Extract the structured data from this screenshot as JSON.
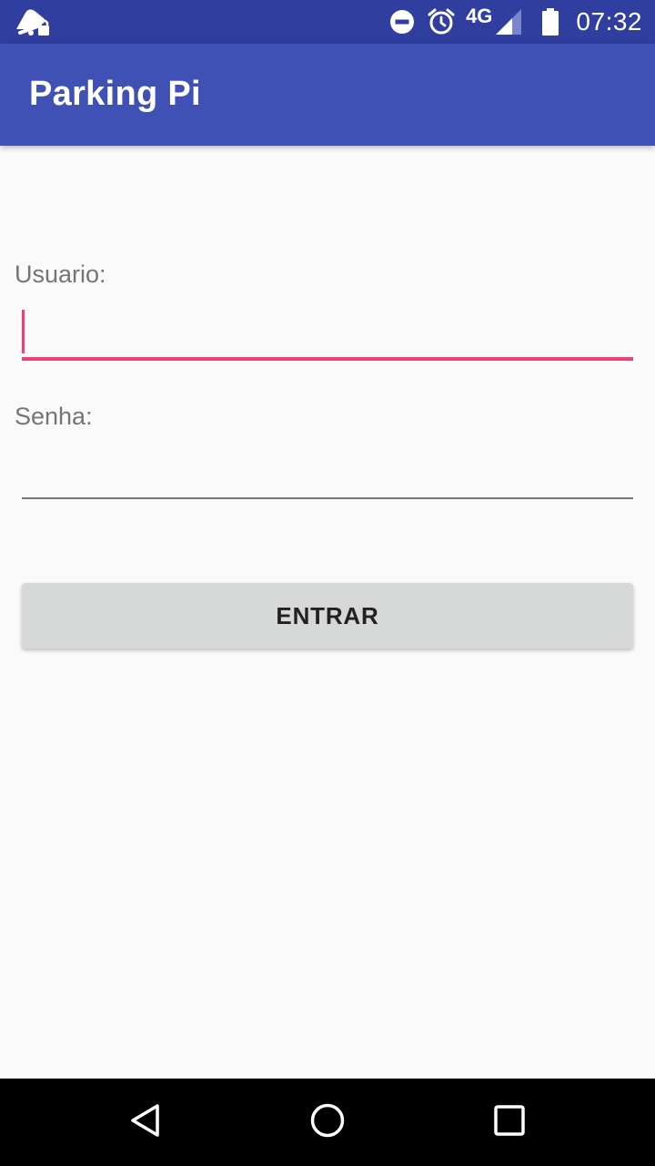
{
  "status_bar": {
    "left_icon": "notification-sleep-lock-icon",
    "icons": [
      "do-not-disturb-icon",
      "alarm-icon",
      "signal-icon",
      "battery-icon"
    ],
    "network": "4G",
    "time": "07:32",
    "color": "#303f9f"
  },
  "app_bar": {
    "title": "Parking Pi",
    "color": "#3f51b5"
  },
  "form": {
    "usuario_label": "Usuario:",
    "usuario_value": "",
    "senha_label": "Senha:",
    "senha_value": "",
    "focus_color": "#ec407a",
    "submit_label": "ENTRAR"
  },
  "nav_bar": {
    "buttons": [
      "back-icon",
      "home-icon",
      "recents-icon"
    ]
  }
}
